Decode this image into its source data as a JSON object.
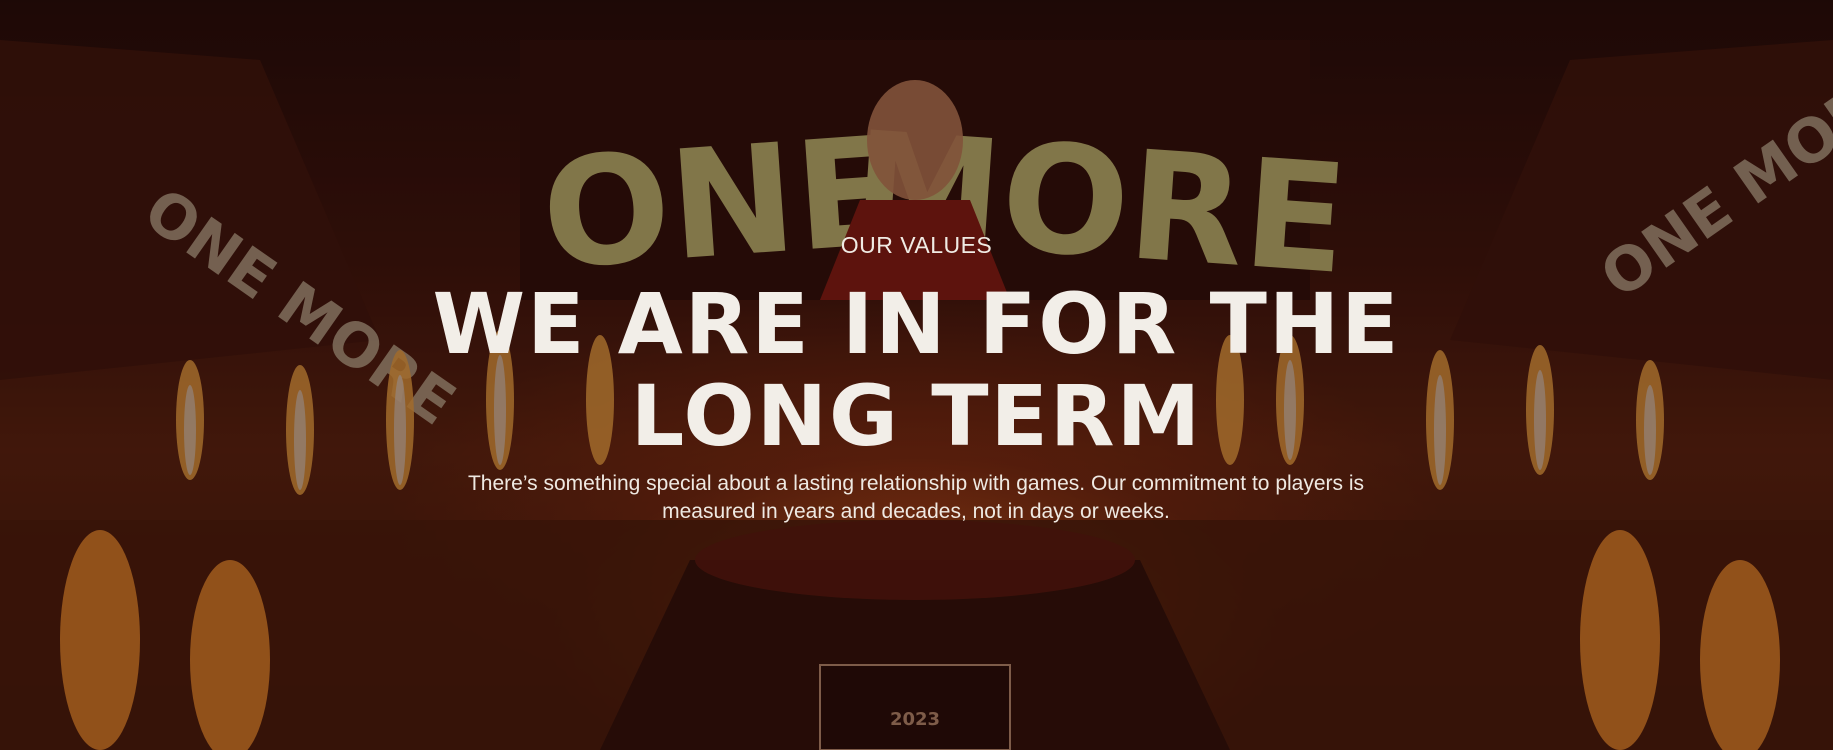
{
  "hero": {
    "eyebrow": "OUR VALUES",
    "headline_line1": "WE ARE IN FOR THE",
    "headline_line2": "LONG TERM",
    "body": "There’s something special about a lasting relationship with games. Our commitment to players is measured in years and decades, not in days or weeks."
  },
  "background": {
    "screen_text_left": "ONE",
    "screen_text_right": "MORE",
    "banner_left": "ONE MORE",
    "banner_right": "ONE MORE",
    "stage_year": "2023",
    "colors": {
      "overlay": "#1e0804",
      "fire": "#ff8a28",
      "screen_text": "#c9c77a",
      "text": "#f2eee8"
    }
  }
}
